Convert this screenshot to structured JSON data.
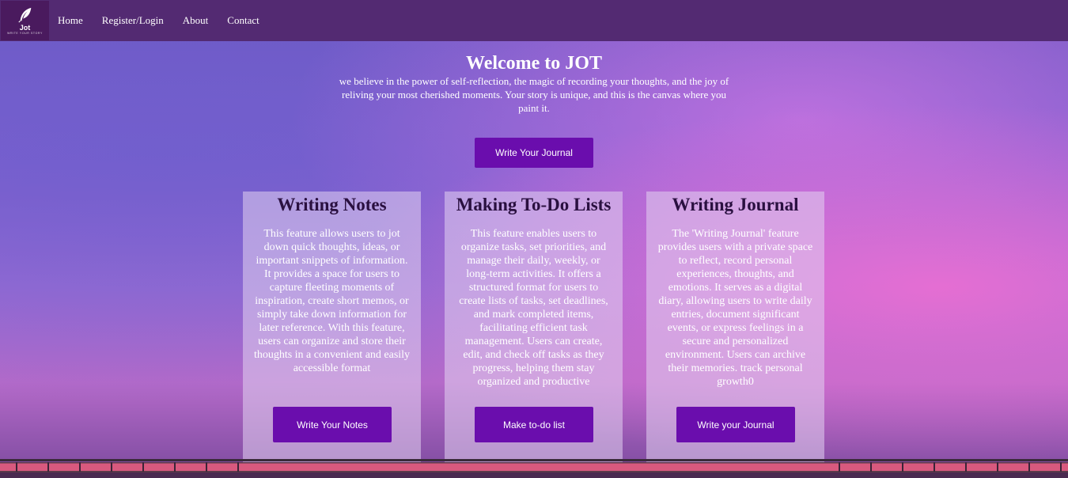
{
  "brand": {
    "logo_text": "Jot",
    "logo_tagline": "WRITE YOUR STORY"
  },
  "nav": {
    "items": [
      "Home",
      "Register/Login",
      "About",
      "Contact"
    ]
  },
  "hero": {
    "title": "Welcome to JOT",
    "description": "we believe in the power of self-reflection, the magic of recording your thoughts, and the joy of reliving your most cherished moments. Your story is unique, and this is the canvas where you paint it.",
    "button_label": "Write Your Journal"
  },
  "cards": [
    {
      "title": "Writing Notes",
      "text": "This feature allows users to jot down quick thoughts, ideas, or important snippets of information. It provides a space for users to capture fleeting moments of inspiration, create short memos, or simply take down information for later reference. With this feature, users can organize and store their thoughts in a convenient and easily accessible format",
      "button_label": "Write Your Notes"
    },
    {
      "title": "Making To-Do Lists",
      "text": "This feature enables users to organize tasks, set priorities, and manage their daily, weekly, or long-term activities. It offers a structured format for users to create lists of tasks, set deadlines, and mark completed items, facilitating efficient task management. Users can create, edit, and check off tasks as they progress, helping them stay organized and productive",
      "button_label": "Make to-do list"
    },
    {
      "title": "Writing Journal",
      "text": "The 'Writing Journal' feature provides users with a private space to reflect, record personal experiences, thoughts, and emotions. It serves as a digital diary, allowing users to write daily entries, document significant events, or express feelings in a secure and personalized environment. Users can archive their memories. track personal growth0",
      "button_label": "Write your Journal"
    }
  ],
  "colors": {
    "navbar": "#532a72",
    "button": "#6a0dad",
    "logo_bg": "#4a1a5e"
  },
  "icons": {
    "logo": "feather-icon"
  }
}
